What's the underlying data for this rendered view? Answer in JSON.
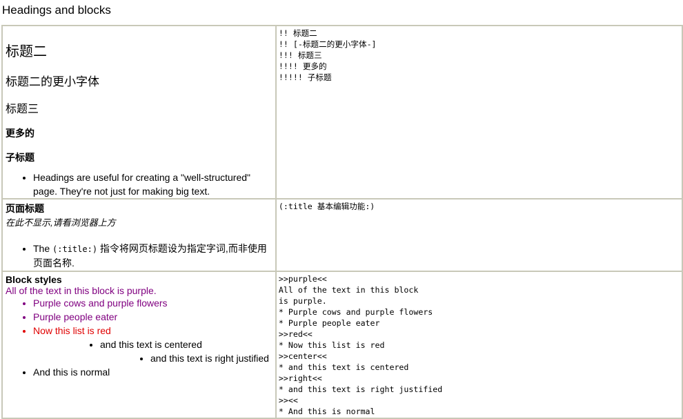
{
  "page": {
    "title": "Headings and blocks"
  },
  "rows": [
    {
      "left": {
        "heading2": "标题二",
        "heading3": "标题二的更小字体",
        "heading4": "标题三",
        "heading5": "更多的",
        "heading6": "子标题",
        "bullet": "Headings are useful for creating a \"well-structured\" page. They're not just for making big text."
      },
      "right": [
        "!! 标题二",
        "!! [-标题二的更小字体-]",
        "!!! 标题三",
        "!!!! 更多的",
        "!!!!! 子标题"
      ]
    },
    {
      "left": {
        "label": "页面标题",
        "note": "在此不显示,请看浏览器上方",
        "bullet_prefix": "The ",
        "bullet_code": "(:title:)",
        "bullet_suffix": " 指令将网页标题设为指定字词,而非使用页面名称."
      },
      "right": [
        "(:title 基本编辑功能:)"
      ]
    },
    {
      "left": {
        "label": "Block styles",
        "purple_text": "All of the text in this block is purple.",
        "purple_items": [
          "Purple cows and purple flowers",
          "Purple people eater"
        ],
        "red_item": "Now this list is red",
        "centered_item": "and this text is centered",
        "right_item": "and this text is right justified",
        "normal_item": "And this is normal"
      },
      "right": [
        ">>purple<<",
        "All of the text in this block",
        "is purple.",
        "* Purple cows and purple flowers",
        "* Purple people eater",
        ">>red<<",
        "* Now this list is red",
        ">>center<<",
        "* and this text is centered",
        ">>right<<",
        "* and this text is right justified",
        ">><<",
        "* And this is normal"
      ]
    }
  ]
}
